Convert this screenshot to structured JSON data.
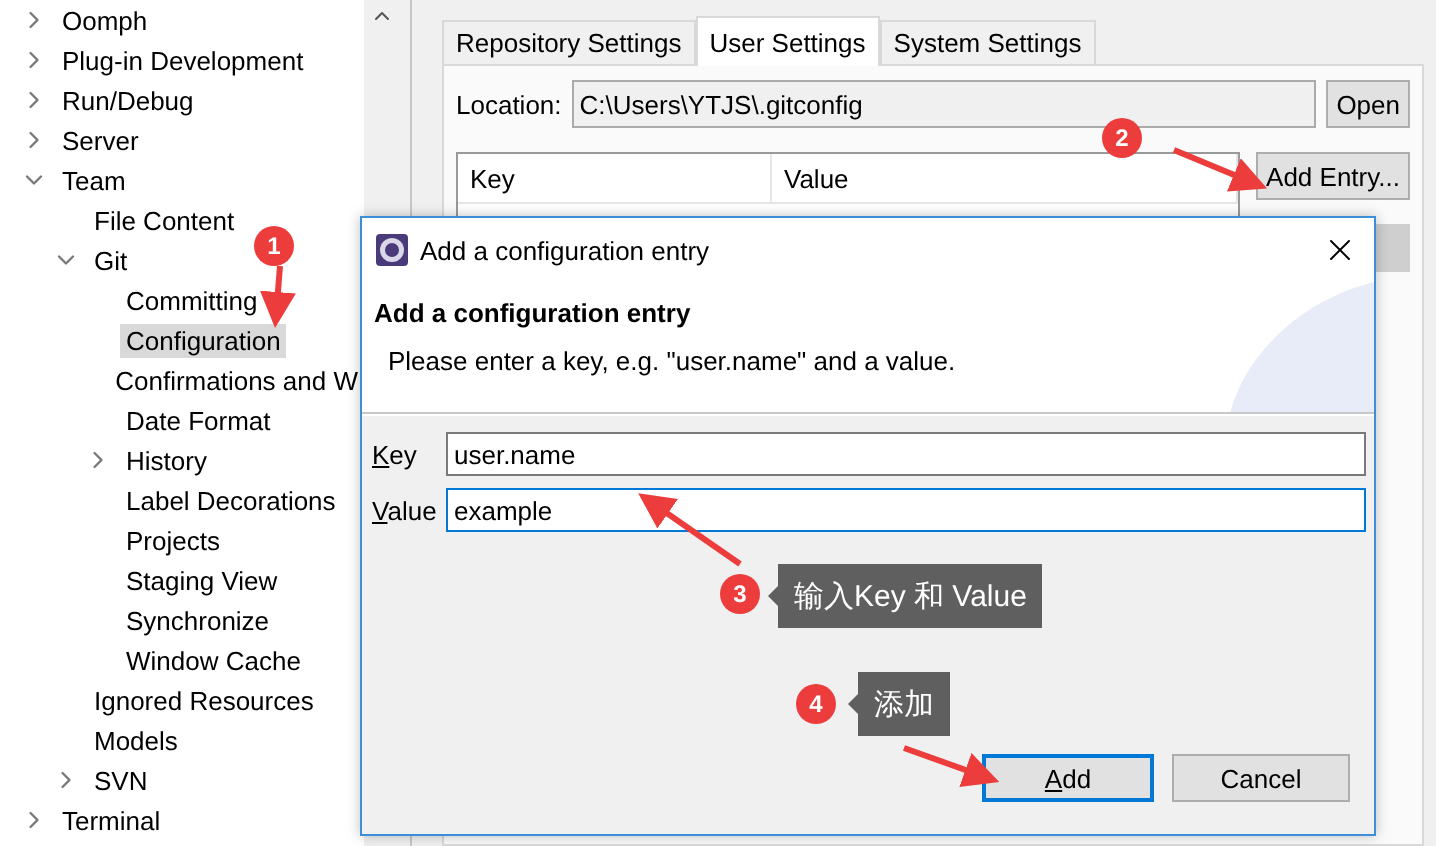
{
  "tree": {
    "items": [
      {
        "label": "Oomph",
        "expanded": false
      },
      {
        "label": "Plug-in Development",
        "expanded": false
      },
      {
        "label": "Run/Debug",
        "expanded": false
      },
      {
        "label": "Server",
        "expanded": false
      },
      {
        "label": "Team",
        "expanded": true,
        "children": [
          {
            "label": "File Content"
          },
          {
            "label": "Git",
            "expanded": true,
            "children": [
              {
                "label": "Committing"
              },
              {
                "label": "Configuration",
                "selected": true
              },
              {
                "label": "Confirmations and W"
              },
              {
                "label": "Date Format"
              },
              {
                "label": "History",
                "expanded": false
              },
              {
                "label": "Label Decorations"
              },
              {
                "label": "Projects"
              },
              {
                "label": "Staging View"
              },
              {
                "label": "Synchronize"
              },
              {
                "label": "Window Cache"
              }
            ]
          },
          {
            "label": "Ignored Resources"
          },
          {
            "label": "Models"
          },
          {
            "label": "SVN",
            "expanded": false
          }
        ]
      },
      {
        "label": "Terminal",
        "expanded": false
      }
    ]
  },
  "tabs": [
    {
      "label": "Repository Settings",
      "selected": false
    },
    {
      "label": "User Settings",
      "selected": true
    },
    {
      "label": "System Settings",
      "selected": false
    }
  ],
  "location": {
    "label": "Location:",
    "value": "C:\\Users\\YTJS\\.gitconfig"
  },
  "open_button": "Open",
  "table": {
    "columns": [
      "Key",
      "Value"
    ]
  },
  "add_entry_button": "Add Entry...",
  "dialog": {
    "title": "Add a configuration entry",
    "heading": "Add a configuration entry",
    "description": "Please enter a key, e.g. \"user.name\" and a value.",
    "fields": [
      {
        "label": "Key",
        "value": "user.name",
        "focused": false
      },
      {
        "label": "Value",
        "value": "example",
        "focused": true
      }
    ],
    "buttons": [
      {
        "label": "Add",
        "default": true
      },
      {
        "label": "Cancel",
        "default": false
      }
    ]
  },
  "annotations": [
    {
      "number": "1"
    },
    {
      "number": "2"
    },
    {
      "number": "3",
      "text": "输入Key 和 Value"
    },
    {
      "number": "4",
      "text": "添加"
    }
  ]
}
